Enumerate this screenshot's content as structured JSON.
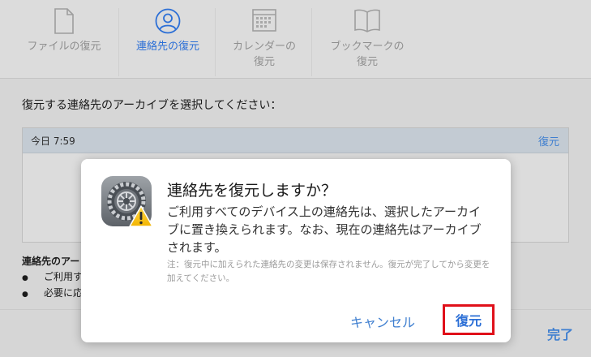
{
  "toolbar": {
    "tabs": [
      {
        "label": "ファイルの復元",
        "icon": "document-icon",
        "active": false
      },
      {
        "label": "連絡先の復元",
        "icon": "contacts-icon",
        "active": true
      },
      {
        "label_line1": "カレンダーの",
        "label_line2": "復元",
        "icon": "calendar-icon",
        "active": false
      },
      {
        "label_line1": "ブックマークの",
        "label_line2": "復元",
        "icon": "bookmark-icon",
        "active": false
      }
    ]
  },
  "main": {
    "prompt": "復元する連絡先のアーカイブを選択してください：",
    "archives": [
      {
        "time": "今日 7:59",
        "action": "復元"
      }
    ],
    "notes_title": "連絡先のアー",
    "notes": [
      "ご利用す",
      "必要に応"
    ],
    "done_label": "完了"
  },
  "dialog": {
    "icon": "system-preferences-warning-icon",
    "title": "連絡先を復元しますか？",
    "message": "ご利用すべてのデバイス上の連絡先は、選択したアーカイブに置き換えられます。なお、現在の連絡先はアーカイブされます。",
    "note": "注：復元中に加えられた連絡先の変更は保存されません。復元が完了してから変更を加えてください。",
    "cancel_label": "キャンセル",
    "restore_label": "復元"
  },
  "colors": {
    "accent": "#3f7fd0",
    "highlight_border": "#e0101a"
  }
}
